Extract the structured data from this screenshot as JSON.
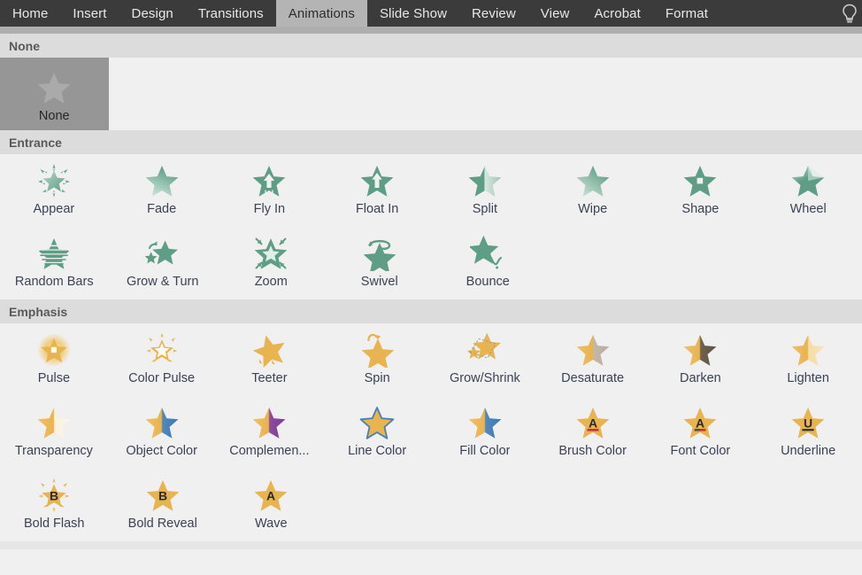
{
  "ribbon": {
    "tabs": [
      {
        "label": "Home",
        "active": false
      },
      {
        "label": "Insert",
        "active": false
      },
      {
        "label": "Design",
        "active": false
      },
      {
        "label": "Transitions",
        "active": false
      },
      {
        "label": "Animations",
        "active": true
      },
      {
        "label": "Slide Show",
        "active": false
      },
      {
        "label": "Review",
        "active": false
      },
      {
        "label": "View",
        "active": false
      },
      {
        "label": "Acrobat",
        "active": false
      },
      {
        "label": "Format",
        "active": false
      }
    ],
    "tell_me_icon": "lightbulb-icon"
  },
  "colors": {
    "entrance": "#5f9e86",
    "entrance_light": "#b6d6c6",
    "emphasis": "#e8b44f",
    "emphasis_light": "#f6e7c4",
    "tab_bar": "#3b3b3b",
    "active_tab": "#b4b4b4",
    "section_header": "#dcdcdc",
    "gallery_bg": "#f0f0f0",
    "none_cell": "#969696",
    "label_text": "#3b4256"
  },
  "sections": [
    {
      "title": "None",
      "name": "section-none",
      "rows": [
        [
          {
            "label": "None",
            "icon": "none-star-icon",
            "style": "none",
            "selected": true
          }
        ]
      ]
    },
    {
      "title": "Entrance",
      "name": "section-entrance",
      "rows": [
        [
          {
            "label": "Appear",
            "icon": "appear-star-icon",
            "style": "entrance"
          },
          {
            "label": "Fade",
            "icon": "fade-star-icon",
            "style": "entrance"
          },
          {
            "label": "Fly In",
            "icon": "fly-in-star-icon",
            "style": "entrance"
          },
          {
            "label": "Float In",
            "icon": "float-in-star-icon",
            "style": "entrance"
          },
          {
            "label": "Split",
            "icon": "split-star-icon",
            "style": "entrance"
          },
          {
            "label": "Wipe",
            "icon": "wipe-star-icon",
            "style": "entrance"
          },
          {
            "label": "Shape",
            "icon": "shape-star-icon",
            "style": "entrance"
          },
          {
            "label": "Wheel",
            "icon": "wheel-star-icon",
            "style": "entrance"
          }
        ],
        [
          {
            "label": "Random Bars",
            "icon": "random-bars-star-icon",
            "style": "entrance"
          },
          {
            "label": "Grow & Turn",
            "icon": "grow-and-turn-star-icon",
            "style": "entrance"
          },
          {
            "label": "Zoom",
            "icon": "zoom-star-icon",
            "style": "entrance"
          },
          {
            "label": "Swivel",
            "icon": "swivel-star-icon",
            "style": "entrance"
          },
          {
            "label": "Bounce",
            "icon": "bounce-star-icon",
            "style": "entrance"
          }
        ]
      ]
    },
    {
      "title": "Emphasis",
      "name": "section-emphasis",
      "rows": [
        [
          {
            "label": "Pulse",
            "icon": "pulse-star-icon",
            "style": "emphasis"
          },
          {
            "label": "Color Pulse",
            "icon": "color-pulse-star-icon",
            "style": "emphasis"
          },
          {
            "label": "Teeter",
            "icon": "teeter-star-icon",
            "style": "emphasis"
          },
          {
            "label": "Spin",
            "icon": "spin-star-icon",
            "style": "emphasis"
          },
          {
            "label": "Grow/Shrink",
            "icon": "grow-shrink-star-icon",
            "style": "emphasis"
          },
          {
            "label": "Desaturate",
            "icon": "desaturate-star-icon",
            "style": "emphasis"
          },
          {
            "label": "Darken",
            "icon": "darken-star-icon",
            "style": "emphasis"
          },
          {
            "label": "Lighten",
            "icon": "lighten-star-icon",
            "style": "emphasis"
          }
        ],
        [
          {
            "label": "Transparency",
            "icon": "transparency-star-icon",
            "style": "emphasis"
          },
          {
            "label": "Object Color",
            "icon": "object-color-star-icon",
            "style": "emphasis"
          },
          {
            "label": "Complemen...",
            "icon": "complementary-color-star-icon",
            "style": "emphasis"
          },
          {
            "label": "Line Color",
            "icon": "line-color-star-icon",
            "style": "emphasis"
          },
          {
            "label": "Fill Color",
            "icon": "fill-color-star-icon",
            "style": "emphasis"
          },
          {
            "label": "Brush Color",
            "icon": "brush-color-star-icon",
            "style": "emphasis"
          },
          {
            "label": "Font Color",
            "icon": "font-color-star-icon",
            "style": "emphasis"
          },
          {
            "label": "Underline",
            "icon": "underline-star-icon",
            "style": "emphasis"
          }
        ],
        [
          {
            "label": "Bold Flash",
            "icon": "bold-flash-star-icon",
            "style": "emphasis"
          },
          {
            "label": "Bold Reveal",
            "icon": "bold-reveal-star-icon",
            "style": "emphasis"
          },
          {
            "label": "Wave",
            "icon": "wave-star-icon",
            "style": "emphasis"
          }
        ]
      ]
    }
  ]
}
